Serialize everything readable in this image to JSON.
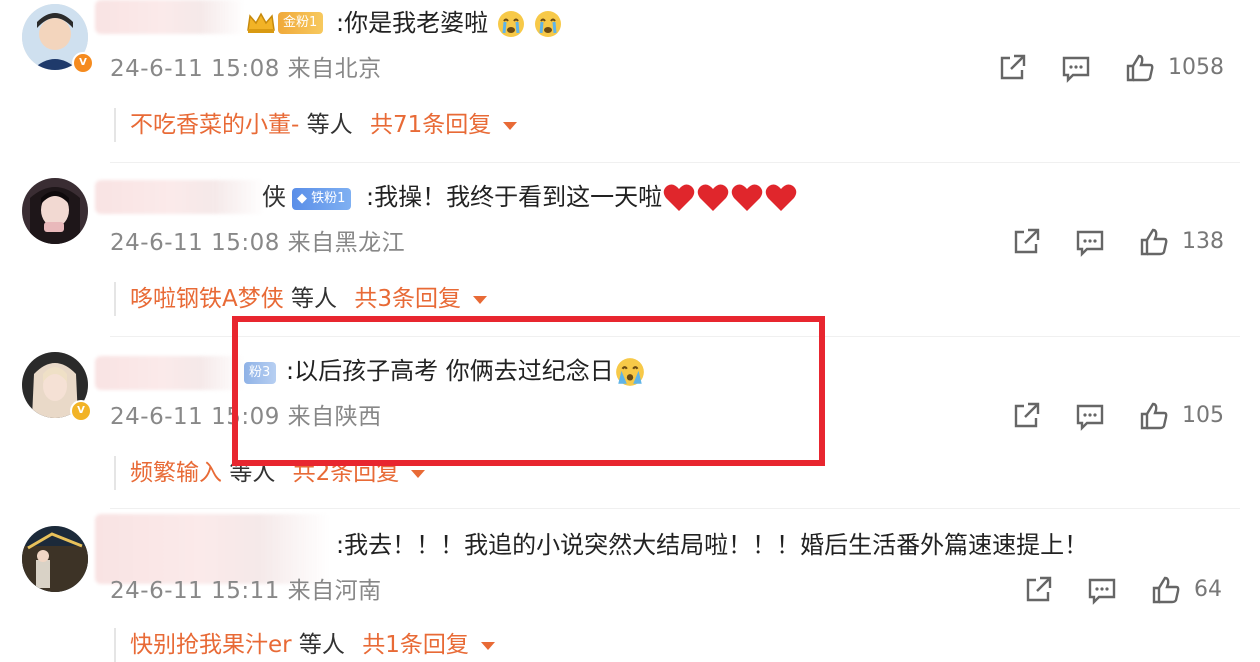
{
  "comments": [
    {
      "fan_badge": "金粉1",
      "text": ":你是我老婆啦",
      "date": "24-6-11 15:08",
      "location": "来自北京",
      "likes": "1058",
      "reply_user": "不吃香菜的小董-",
      "reply_etc": "等人",
      "reply_total": "共71条回复"
    },
    {
      "name_tail": "侠",
      "fan_badge": "铁粉1",
      "text": ":我操！我终于看到这一天啦",
      "date": "24-6-11 15:08",
      "location": "来自黑龙江",
      "likes": "138",
      "reply_user": "哆啦钢铁A梦侠",
      "reply_etc": "等人",
      "reply_total": "共3条回复"
    },
    {
      "fan_badge": "粉3",
      "text": ":以后孩子高考 你俩去过纪念日",
      "date": "24-6-11 15:09",
      "location": "来自陕西",
      "likes": "105",
      "reply_user": "频繁输入",
      "reply_etc": "等人",
      "reply_total": "共2条回复"
    },
    {
      "text": ":我去！！！我追的小说突然大结局啦！！！婚后生活番外篇速速提上！",
      "date": "24-6-11 15:11",
      "location": "来自河南",
      "likes": "64",
      "reply_user": "快别抢我果汁er",
      "reply_etc": "等人",
      "reply_total": "共1条回复"
    }
  ],
  "colors": {
    "reply_accent": "#e86a36",
    "highlight_box": "#e8262f",
    "meta_gray": "#888888"
  },
  "icons": [
    "share-icon",
    "comment-icon",
    "like-icon",
    "caret-down-icon",
    "crown-icon",
    "heart-icon",
    "crying-emoji-icon"
  ]
}
